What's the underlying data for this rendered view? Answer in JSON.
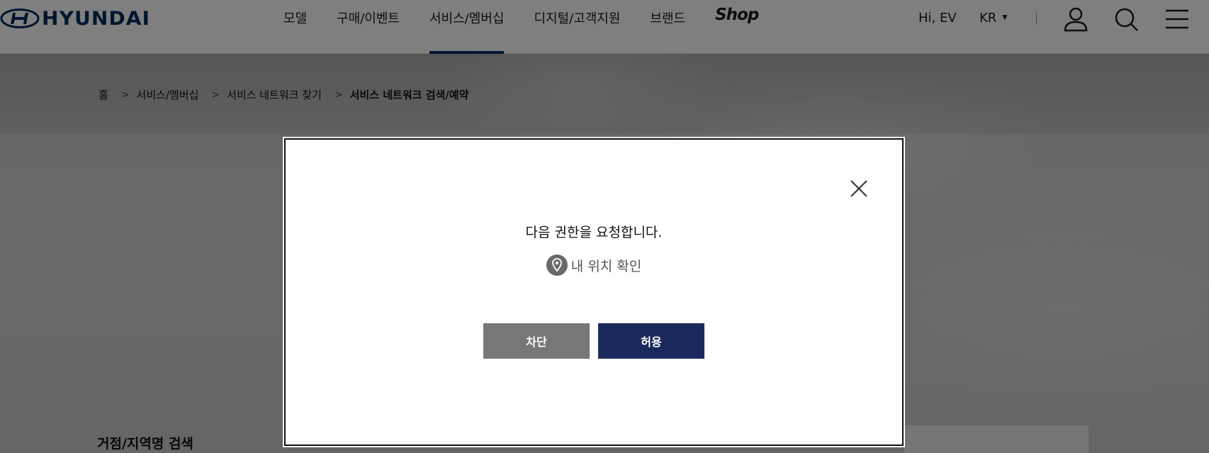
{
  "brand": {
    "name": "HYUNDAI",
    "color": "#002c5f"
  },
  "nav": {
    "items": [
      "모델",
      "구매/이벤트",
      "서비스/멤버십",
      "디지털/고객지원",
      "브랜드"
    ],
    "active_index": 2,
    "shop_label": "Shop"
  },
  "utility": {
    "greeting": "Hi, EV",
    "language": "KR"
  },
  "icons": {
    "user": "user-icon",
    "search": "search-icon",
    "menu": "hamburger-menu-icon",
    "close": "close-icon",
    "location": "location-pin-icon"
  },
  "breadcrumb": [
    "홈",
    "서비스/멤버십",
    "서비스 네트워크 찾기",
    "서비스 네트워크 검색/예약"
  ],
  "hero": {
    "search_label": "거점/지역명 검색"
  },
  "modal": {
    "title": "다음 권한을 요청합니다.",
    "permission": "내 위치 확인",
    "block_label": "차단",
    "allow_label": "허용"
  },
  "colors": {
    "allow_button": "#1b2a5c",
    "block_button": "#777777"
  }
}
